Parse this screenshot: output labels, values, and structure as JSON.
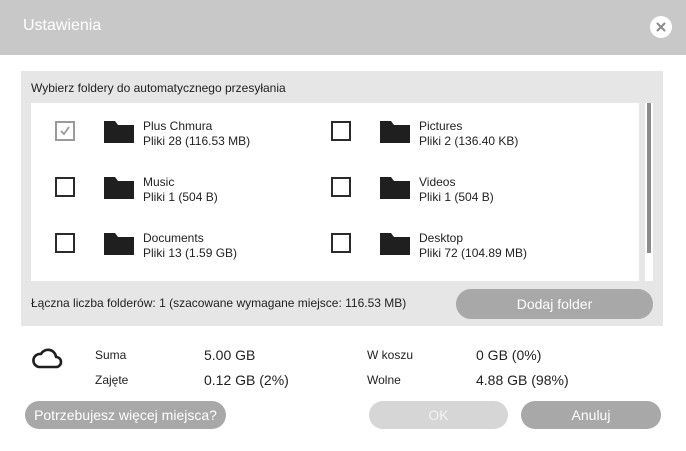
{
  "window": {
    "title": "Ustawienia",
    "close_icon": "close-icon"
  },
  "folders_panel": {
    "heading": "Wybierz foldery do automatycznego przesyłania",
    "items": [
      {
        "name": "Plus Chmura",
        "meta": "Pliki 28 (116.53 MB)",
        "checked": true
      },
      {
        "name": "Pictures",
        "meta": "Pliki 2 (136.40 KB)",
        "checked": false
      },
      {
        "name": "Music",
        "meta": "Pliki 1 (504 B)",
        "checked": false
      },
      {
        "name": "Videos",
        "meta": "Pliki 1 (504 B)",
        "checked": false
      },
      {
        "name": "Documents",
        "meta": "Pliki 13 (1.59 GB)",
        "checked": false
      },
      {
        "name": "Desktop",
        "meta": "Pliki 72 (104.89 MB)",
        "checked": false
      }
    ],
    "total_label": "Łączna liczba folderów: 1 (szacowane wymagane miejsce: 116.53 MB)",
    "add_folder_label": "Dodaj folder"
  },
  "storage": {
    "icon": "cloud-icon",
    "total_label": "Suma",
    "total_value": "5.00 GB",
    "used_label": "Zajęte",
    "used_value": "0.12 GB (2%)",
    "trash_label": "W koszu",
    "trash_value": "0 GB (0%)",
    "free_label": "Wolne",
    "free_value": "4.88 GB (98%)"
  },
  "footer": {
    "more_space_label": "Potrzebujesz więcej miejsca?",
    "ok_label": "OK",
    "cancel_label": "Anuluj"
  },
  "colors": {
    "titlebar": "#c8c8c8",
    "panel": "#e6e6e6",
    "button": "#a8a8a8",
    "button_disabled": "#d6d6d6"
  }
}
